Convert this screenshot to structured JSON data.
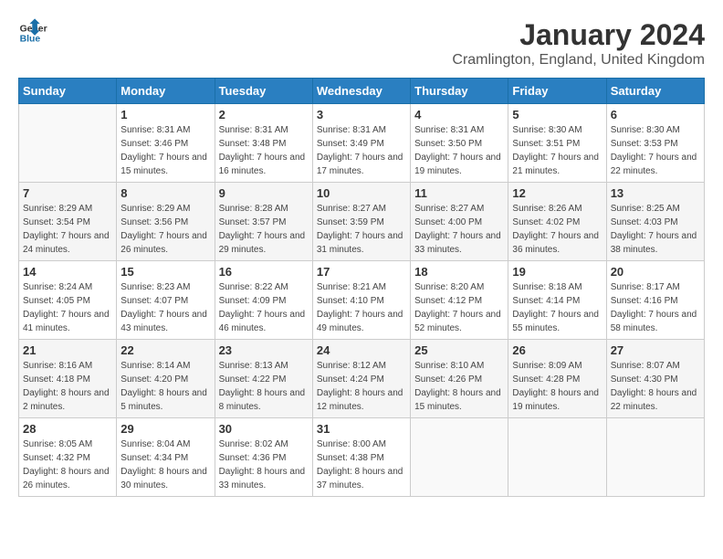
{
  "header": {
    "logo_line1": "General",
    "logo_line2": "Blue",
    "month_title": "January 2024",
    "location": "Cramlington, England, United Kingdom"
  },
  "weekdays": [
    "Sunday",
    "Monday",
    "Tuesday",
    "Wednesday",
    "Thursday",
    "Friday",
    "Saturday"
  ],
  "weeks": [
    [
      {
        "day": "",
        "sunrise": "",
        "sunset": "",
        "daylight": ""
      },
      {
        "day": "1",
        "sunrise": "Sunrise: 8:31 AM",
        "sunset": "Sunset: 3:46 PM",
        "daylight": "Daylight: 7 hours and 15 minutes."
      },
      {
        "day": "2",
        "sunrise": "Sunrise: 8:31 AM",
        "sunset": "Sunset: 3:48 PM",
        "daylight": "Daylight: 7 hours and 16 minutes."
      },
      {
        "day": "3",
        "sunrise": "Sunrise: 8:31 AM",
        "sunset": "Sunset: 3:49 PM",
        "daylight": "Daylight: 7 hours and 17 minutes."
      },
      {
        "day": "4",
        "sunrise": "Sunrise: 8:31 AM",
        "sunset": "Sunset: 3:50 PM",
        "daylight": "Daylight: 7 hours and 19 minutes."
      },
      {
        "day": "5",
        "sunrise": "Sunrise: 8:30 AM",
        "sunset": "Sunset: 3:51 PM",
        "daylight": "Daylight: 7 hours and 21 minutes."
      },
      {
        "day": "6",
        "sunrise": "Sunrise: 8:30 AM",
        "sunset": "Sunset: 3:53 PM",
        "daylight": "Daylight: 7 hours and 22 minutes."
      }
    ],
    [
      {
        "day": "7",
        "sunrise": "Sunrise: 8:29 AM",
        "sunset": "Sunset: 3:54 PM",
        "daylight": "Daylight: 7 hours and 24 minutes."
      },
      {
        "day": "8",
        "sunrise": "Sunrise: 8:29 AM",
        "sunset": "Sunset: 3:56 PM",
        "daylight": "Daylight: 7 hours and 26 minutes."
      },
      {
        "day": "9",
        "sunrise": "Sunrise: 8:28 AM",
        "sunset": "Sunset: 3:57 PM",
        "daylight": "Daylight: 7 hours and 29 minutes."
      },
      {
        "day": "10",
        "sunrise": "Sunrise: 8:27 AM",
        "sunset": "Sunset: 3:59 PM",
        "daylight": "Daylight: 7 hours and 31 minutes."
      },
      {
        "day": "11",
        "sunrise": "Sunrise: 8:27 AM",
        "sunset": "Sunset: 4:00 PM",
        "daylight": "Daylight: 7 hours and 33 minutes."
      },
      {
        "day": "12",
        "sunrise": "Sunrise: 8:26 AM",
        "sunset": "Sunset: 4:02 PM",
        "daylight": "Daylight: 7 hours and 36 minutes."
      },
      {
        "day": "13",
        "sunrise": "Sunrise: 8:25 AM",
        "sunset": "Sunset: 4:03 PM",
        "daylight": "Daylight: 7 hours and 38 minutes."
      }
    ],
    [
      {
        "day": "14",
        "sunrise": "Sunrise: 8:24 AM",
        "sunset": "Sunset: 4:05 PM",
        "daylight": "Daylight: 7 hours and 41 minutes."
      },
      {
        "day": "15",
        "sunrise": "Sunrise: 8:23 AM",
        "sunset": "Sunset: 4:07 PM",
        "daylight": "Daylight: 7 hours and 43 minutes."
      },
      {
        "day": "16",
        "sunrise": "Sunrise: 8:22 AM",
        "sunset": "Sunset: 4:09 PM",
        "daylight": "Daylight: 7 hours and 46 minutes."
      },
      {
        "day": "17",
        "sunrise": "Sunrise: 8:21 AM",
        "sunset": "Sunset: 4:10 PM",
        "daylight": "Daylight: 7 hours and 49 minutes."
      },
      {
        "day": "18",
        "sunrise": "Sunrise: 8:20 AM",
        "sunset": "Sunset: 4:12 PM",
        "daylight": "Daylight: 7 hours and 52 minutes."
      },
      {
        "day": "19",
        "sunrise": "Sunrise: 8:18 AM",
        "sunset": "Sunset: 4:14 PM",
        "daylight": "Daylight: 7 hours and 55 minutes."
      },
      {
        "day": "20",
        "sunrise": "Sunrise: 8:17 AM",
        "sunset": "Sunset: 4:16 PM",
        "daylight": "Daylight: 7 hours and 58 minutes."
      }
    ],
    [
      {
        "day": "21",
        "sunrise": "Sunrise: 8:16 AM",
        "sunset": "Sunset: 4:18 PM",
        "daylight": "Daylight: 8 hours and 2 minutes."
      },
      {
        "day": "22",
        "sunrise": "Sunrise: 8:14 AM",
        "sunset": "Sunset: 4:20 PM",
        "daylight": "Daylight: 8 hours and 5 minutes."
      },
      {
        "day": "23",
        "sunrise": "Sunrise: 8:13 AM",
        "sunset": "Sunset: 4:22 PM",
        "daylight": "Daylight: 8 hours and 8 minutes."
      },
      {
        "day": "24",
        "sunrise": "Sunrise: 8:12 AM",
        "sunset": "Sunset: 4:24 PM",
        "daylight": "Daylight: 8 hours and 12 minutes."
      },
      {
        "day": "25",
        "sunrise": "Sunrise: 8:10 AM",
        "sunset": "Sunset: 4:26 PM",
        "daylight": "Daylight: 8 hours and 15 minutes."
      },
      {
        "day": "26",
        "sunrise": "Sunrise: 8:09 AM",
        "sunset": "Sunset: 4:28 PM",
        "daylight": "Daylight: 8 hours and 19 minutes."
      },
      {
        "day": "27",
        "sunrise": "Sunrise: 8:07 AM",
        "sunset": "Sunset: 4:30 PM",
        "daylight": "Daylight: 8 hours and 22 minutes."
      }
    ],
    [
      {
        "day": "28",
        "sunrise": "Sunrise: 8:05 AM",
        "sunset": "Sunset: 4:32 PM",
        "daylight": "Daylight: 8 hours and 26 minutes."
      },
      {
        "day": "29",
        "sunrise": "Sunrise: 8:04 AM",
        "sunset": "Sunset: 4:34 PM",
        "daylight": "Daylight: 8 hours and 30 minutes."
      },
      {
        "day": "30",
        "sunrise": "Sunrise: 8:02 AM",
        "sunset": "Sunset: 4:36 PM",
        "daylight": "Daylight: 8 hours and 33 minutes."
      },
      {
        "day": "31",
        "sunrise": "Sunrise: 8:00 AM",
        "sunset": "Sunset: 4:38 PM",
        "daylight": "Daylight: 8 hours and 37 minutes."
      },
      {
        "day": "",
        "sunrise": "",
        "sunset": "",
        "daylight": ""
      },
      {
        "day": "",
        "sunrise": "",
        "sunset": "",
        "daylight": ""
      },
      {
        "day": "",
        "sunrise": "",
        "sunset": "",
        "daylight": ""
      }
    ]
  ]
}
